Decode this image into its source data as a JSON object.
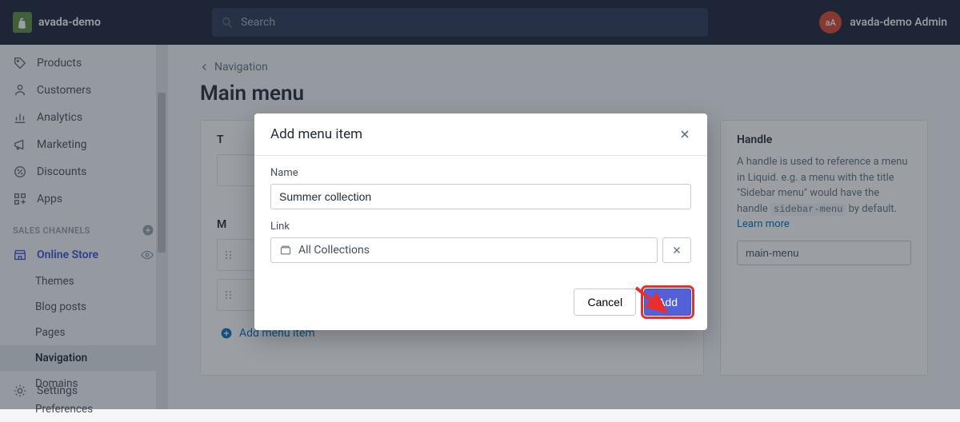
{
  "header": {
    "store_name": "avada-demo",
    "search_placeholder": "Search",
    "avatar_initials": "aA",
    "user_label": "avada-demo Admin"
  },
  "sidebar": {
    "items": [
      {
        "label": "Products"
      },
      {
        "label": "Customers"
      },
      {
        "label": "Analytics"
      },
      {
        "label": "Marketing"
      },
      {
        "label": "Discounts"
      },
      {
        "label": "Apps"
      }
    ],
    "section_label": "SALES CHANNELS",
    "online_store": "Online Store",
    "sub_items": [
      {
        "label": "Themes"
      },
      {
        "label": "Blog posts"
      },
      {
        "label": "Pages"
      },
      {
        "label": "Navigation"
      },
      {
        "label": "Domains"
      },
      {
        "label": "Preferences"
      }
    ],
    "settings": "Settings"
  },
  "main": {
    "back_label": "Navigation",
    "page_title": "Main menu",
    "left_panel_label_1": "T",
    "left_panel_label_2": "M",
    "add_menu_item": "Add menu item",
    "handle_title": "Handle",
    "handle_desc_1": "A handle is used to reference a menu in Liquid. e.g. a menu with the title \"Sidebar menu\" would have the handle ",
    "handle_code": "sidebar-menu",
    "handle_desc_2": " by default. ",
    "learn_more": "Learn more",
    "handle_value": "main-menu"
  },
  "modal": {
    "title": "Add menu item",
    "name_label": "Name",
    "name_value": "Summer collection",
    "link_label": "Link",
    "link_value": "All Collections",
    "cancel": "Cancel",
    "add": "Add"
  }
}
